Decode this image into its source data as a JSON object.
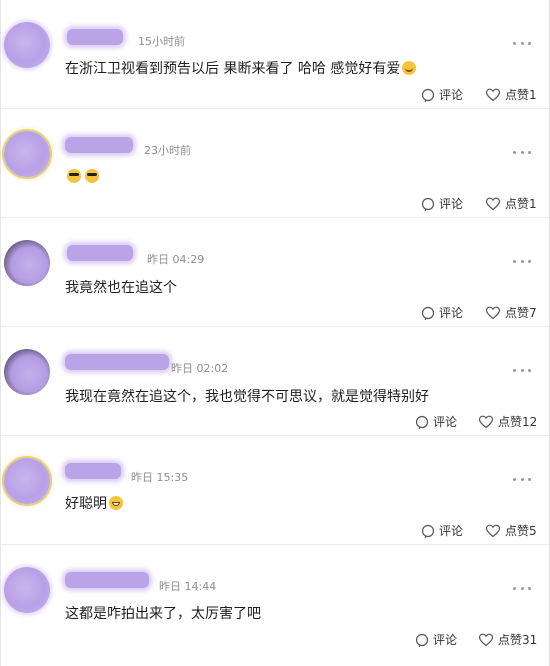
{
  "comments": [
    {
      "time": "15小时前",
      "text": "在浙江卫视看到预告以后 果断来看了 哈哈 感觉好有爱",
      "emoji": "smile-emoji",
      "comment_label": "评论",
      "like_label": "点赞1"
    },
    {
      "time": "23小时前",
      "text": "",
      "emoji": "sunglasses-emoji",
      "comment_label": "评论",
      "like_label": "点赞1"
    },
    {
      "time": "昨日 04:29",
      "text": "我竟然也在追这个",
      "emoji": "",
      "comment_label": "评论",
      "like_label": "点赞7"
    },
    {
      "time": "昨日 02:02",
      "text": "我现在竟然在追这个，我也觉得不可思议，就是觉得特别好",
      "emoji": "",
      "comment_label": "评论",
      "like_label": "点赞12"
    },
    {
      "time": "昨日 15:35",
      "text": "好聪明",
      "emoji": "grin-emoji",
      "comment_label": "评论",
      "like_label": "点赞5"
    },
    {
      "time": "昨日 14:44",
      "text": "这都是咋拍出来了，太厉害了吧",
      "emoji": "",
      "comment_label": "评论",
      "like_label": "点赞31"
    }
  ],
  "icons": {
    "comment": "comment-icon",
    "like": "heart-icon",
    "more": "more-dots-icon"
  },
  "colors": {
    "blur_purple": "#bba3e8",
    "meta_gray": "#8f8f8f",
    "emoji_yellow": "#f5c43a"
  }
}
